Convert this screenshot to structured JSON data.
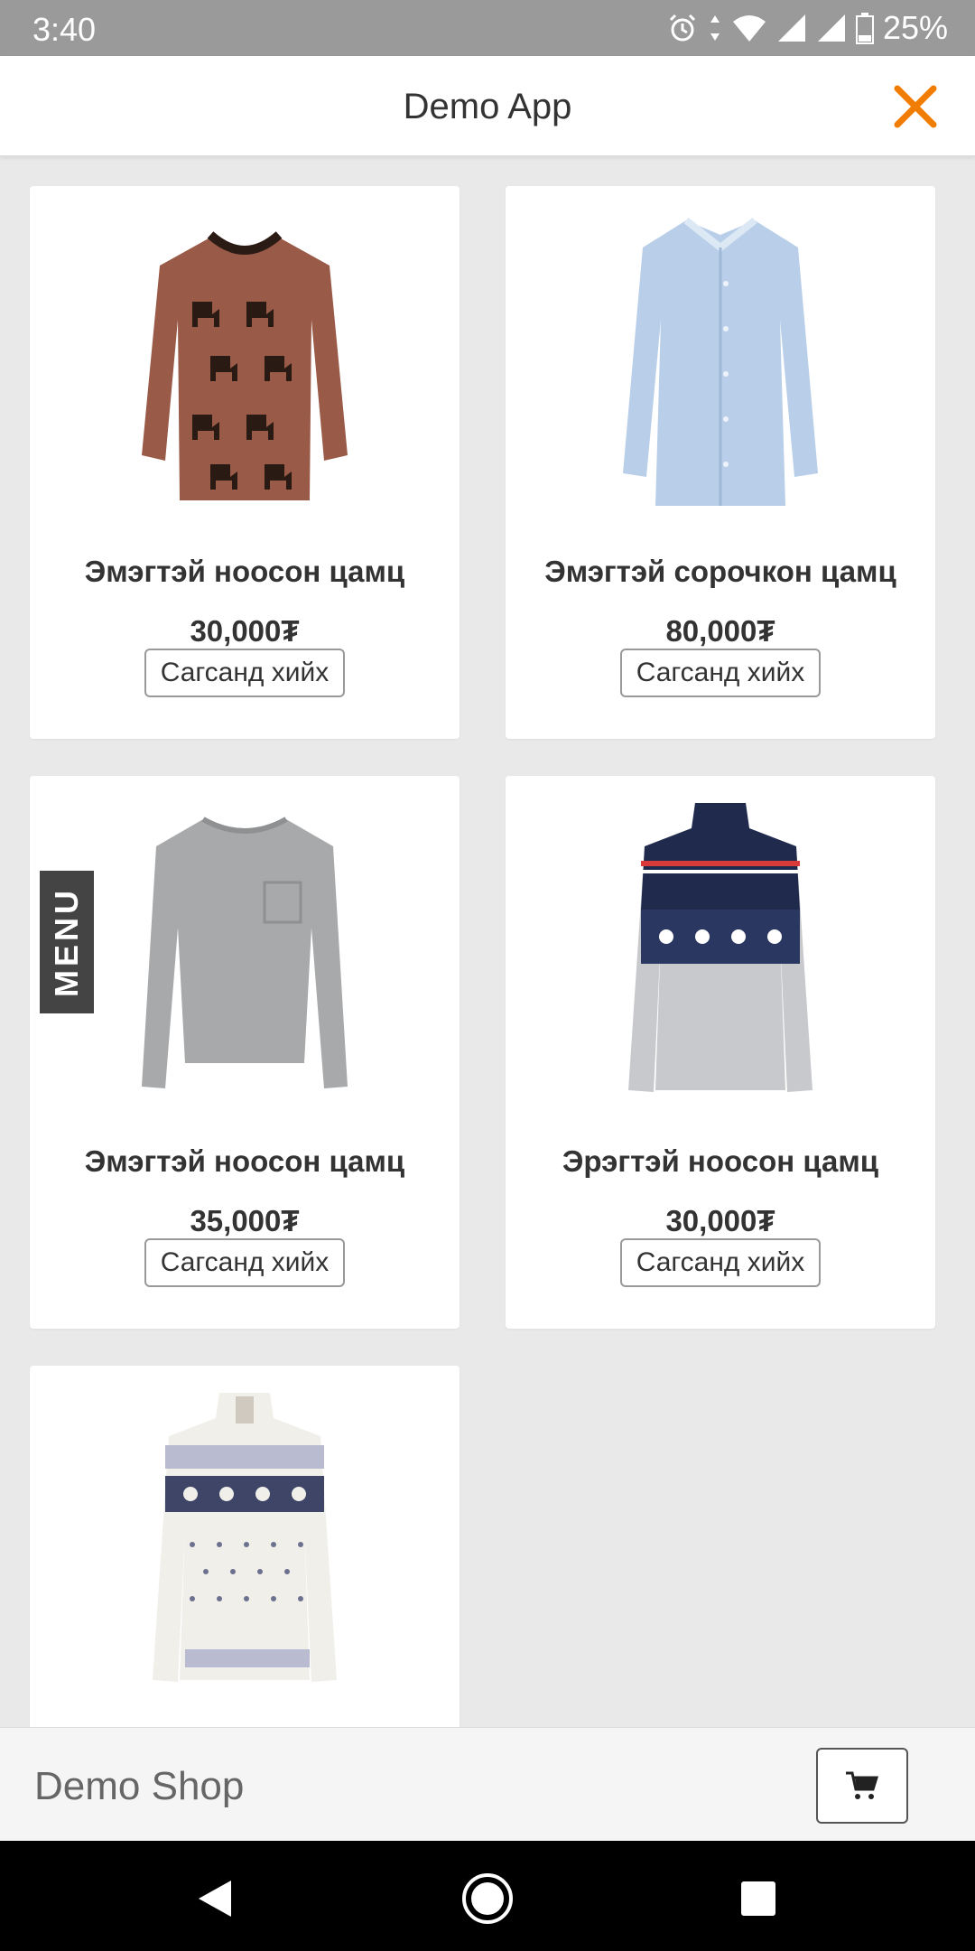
{
  "status_bar": {
    "time": "3:40",
    "battery": "25%",
    "icons": [
      "alarm-icon",
      "data-arrows-icon",
      "wifi-icon",
      "signal-icon",
      "signal-icon",
      "battery-icon"
    ]
  },
  "header": {
    "title": "Demo App",
    "close_icon": "close-icon",
    "accent_color": "#f07d00"
  },
  "products": [
    {
      "name": "Эмэгтэй ноосон цамц",
      "price": "30,000₮",
      "add_label": "Сагсанд хийх",
      "image": "brown-reindeer-sweater"
    },
    {
      "name": "Эмэгтэй сорочкон цамц",
      "price": "80,000₮",
      "add_label": "Сагсанд хийх",
      "image": "light-blue-shirt"
    },
    {
      "name": "Эмэгтэй ноосон цамц",
      "price": "35,000₮",
      "add_label": "Сагсанд хийх",
      "image": "grey-knit-sweater"
    },
    {
      "name": "Эрэгтэй ноосон цамц",
      "price": "30,000₮",
      "add_label": "Сагсанд хийх",
      "image": "navy-fair-isle-sweater"
    },
    {
      "name": "",
      "price": "",
      "add_label": "",
      "image": "white-snowflake-sweater"
    }
  ],
  "menu_tab": {
    "label": "MENU"
  },
  "bottom_bar": {
    "shop_name": "Demo Shop",
    "cart_icon": "cart-icon"
  },
  "nav_bar": {
    "buttons": [
      "back-icon",
      "home-icon",
      "recents-icon"
    ]
  }
}
